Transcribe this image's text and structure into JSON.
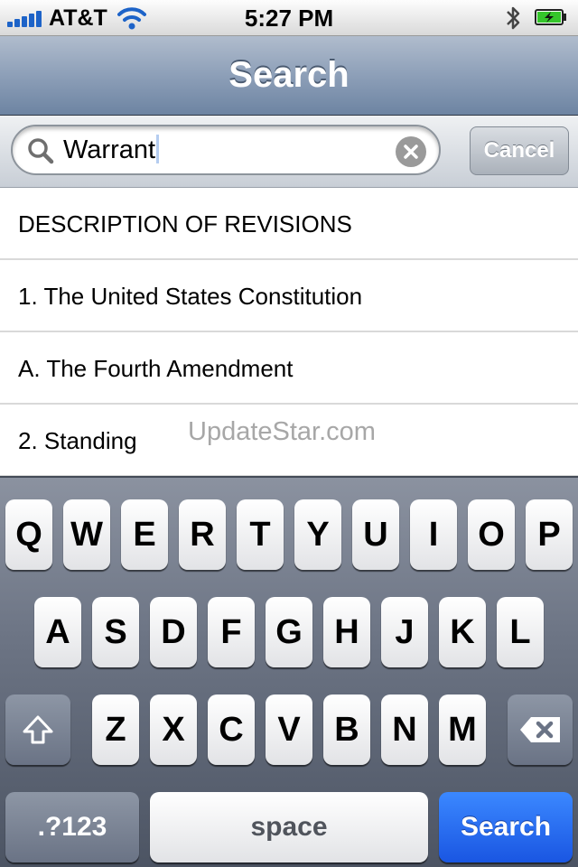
{
  "status_bar": {
    "carrier": "AT&T",
    "time": "5:27 PM",
    "icons": [
      "signal-icon",
      "wifi-icon",
      "bluetooth-icon",
      "battery-charging-icon"
    ]
  },
  "nav": {
    "title": "Search"
  },
  "search": {
    "value": "Warrant",
    "cancel_label": "Cancel",
    "icons": [
      "search-icon",
      "clear-icon"
    ]
  },
  "results": [
    "DESCRIPTION OF REVISIONS",
    "1. The United States Constitution",
    "A. The Fourth Amendment",
    "2. Standing"
  ],
  "watermark": "UpdateStar.com",
  "keyboard": {
    "row1": [
      "Q",
      "W",
      "E",
      "R",
      "T",
      "Y",
      "U",
      "I",
      "O",
      "P"
    ],
    "row2": [
      "A",
      "S",
      "D",
      "F",
      "G",
      "H",
      "J",
      "K",
      "L"
    ],
    "row3": [
      "Z",
      "X",
      "C",
      "V",
      "B",
      "N",
      "M"
    ],
    "numbers_label": ".?123",
    "space_label": "space",
    "search_label": "Search",
    "icons": [
      "shift-icon",
      "backspace-icon"
    ]
  },
  "colors": {
    "navbar": "#8d9fb8",
    "search_key": "#1a56e2",
    "keyboard_bg": "#6d7585"
  }
}
